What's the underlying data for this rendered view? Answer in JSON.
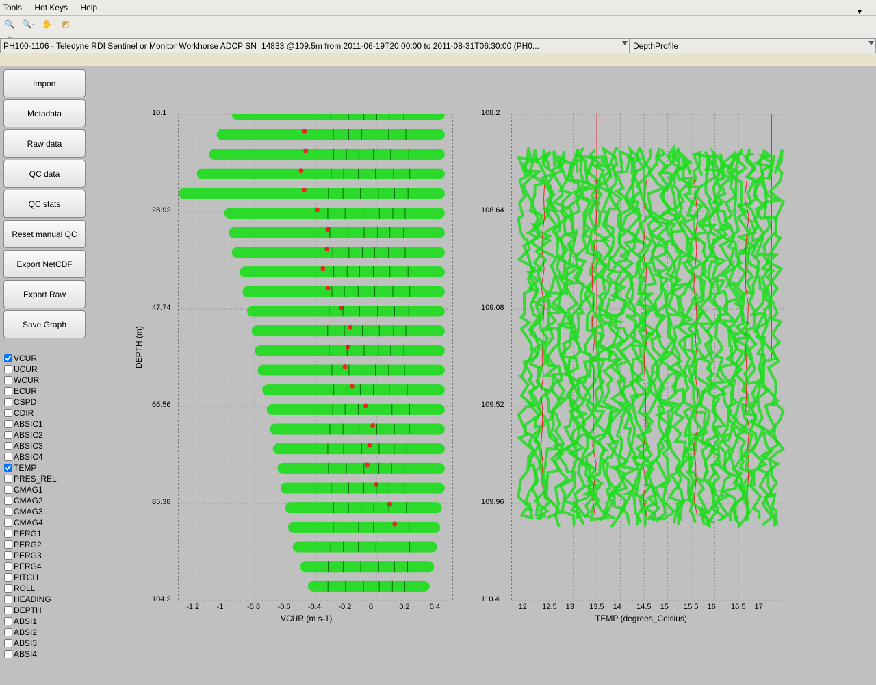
{
  "menu": {
    "tools": "Tools",
    "hotkeys": "Hot Keys",
    "help": "Help"
  },
  "dropdown1": "PH100-1106 - Teledyne RDI Sentinel or Monitor Workhorse ADCP SN=14833 @109.5m from 2011-06-19T20:00:00 to 2011-08-31T06:30:00 (PH0...",
  "dropdown2": "DepthProfile",
  "buttons": [
    "Import",
    "Metadata",
    "Raw data",
    "QC data",
    "QC stats",
    "Reset manual QC",
    "Export NetCDF",
    "Export Raw",
    "Save Graph"
  ],
  "vars": [
    {
      "name": "VCUR",
      "checked": true
    },
    {
      "name": "UCUR",
      "checked": false
    },
    {
      "name": "WCUR",
      "checked": false
    },
    {
      "name": "ECUR",
      "checked": false
    },
    {
      "name": "CSPD",
      "checked": false
    },
    {
      "name": "CDIR",
      "checked": false
    },
    {
      "name": "ABSIC1",
      "checked": false
    },
    {
      "name": "ABSIC2",
      "checked": false
    },
    {
      "name": "ABSIC3",
      "checked": false
    },
    {
      "name": "ABSIC4",
      "checked": false
    },
    {
      "name": "TEMP",
      "checked": true
    },
    {
      "name": "PRES_REL",
      "checked": false
    },
    {
      "name": "CMAG1",
      "checked": false
    },
    {
      "name": "CMAG2",
      "checked": false
    },
    {
      "name": "CMAG3",
      "checked": false
    },
    {
      "name": "CMAG4",
      "checked": false
    },
    {
      "name": "PERG1",
      "checked": false
    },
    {
      "name": "PERG2",
      "checked": false
    },
    {
      "name": "PERG3",
      "checked": false
    },
    {
      "name": "PERG4",
      "checked": false
    },
    {
      "name": "PITCH",
      "checked": false
    },
    {
      "name": "ROLL",
      "checked": false
    },
    {
      "name": "HEADING",
      "checked": false
    },
    {
      "name": "DEPTH",
      "checked": false
    },
    {
      "name": "ABSI1",
      "checked": false
    },
    {
      "name": "ABSI2",
      "checked": false
    },
    {
      "name": "ABSI3",
      "checked": false
    },
    {
      "name": "ABSI4",
      "checked": false
    }
  ],
  "chart_data": [
    {
      "type": "scatter-depth-profile",
      "title": "",
      "xlabel": "VCUR (m s-1)",
      "ylabel": "DEPTH (m)",
      "xlim": [
        -1.3,
        0.5
      ],
      "ylim": [
        104.2,
        10.1
      ],
      "xticks": [
        -1.2,
        -1,
        -0.8,
        -0.6,
        -0.4,
        -0.2,
        0,
        0.2,
        0.4
      ],
      "yticks": [
        10.1,
        28.92,
        47.74,
        66.56,
        85.38,
        104.2
      ],
      "bands": [
        {
          "depth": 10.1,
          "xmin": -0.95,
          "xmax": 0.45
        },
        {
          "depth": 14.0,
          "xmin": -1.05,
          "xmax": 0.45
        },
        {
          "depth": 17.8,
          "xmin": -1.1,
          "xmax": 0.45
        },
        {
          "depth": 21.6,
          "xmin": -1.18,
          "xmax": 0.45
        },
        {
          "depth": 25.4,
          "xmin": -1.3,
          "xmax": 0.45
        },
        {
          "depth": 29.2,
          "xmin": -1.0,
          "xmax": 0.45
        },
        {
          "depth": 33.0,
          "xmin": -0.97,
          "xmax": 0.45
        },
        {
          "depth": 36.8,
          "xmin": -0.95,
          "xmax": 0.45
        },
        {
          "depth": 40.6,
          "xmin": -0.9,
          "xmax": 0.45
        },
        {
          "depth": 44.4,
          "xmin": -0.88,
          "xmax": 0.45
        },
        {
          "depth": 48.2,
          "xmin": -0.85,
          "xmax": 0.45
        },
        {
          "depth": 52.0,
          "xmin": -0.82,
          "xmax": 0.45
        },
        {
          "depth": 55.8,
          "xmin": -0.8,
          "xmax": 0.45
        },
        {
          "depth": 59.6,
          "xmin": -0.78,
          "xmax": 0.45
        },
        {
          "depth": 63.4,
          "xmin": -0.75,
          "xmax": 0.45
        },
        {
          "depth": 67.2,
          "xmin": -0.72,
          "xmax": 0.45
        },
        {
          "depth": 71.0,
          "xmin": -0.7,
          "xmax": 0.45
        },
        {
          "depth": 74.8,
          "xmin": -0.68,
          "xmax": 0.45
        },
        {
          "depth": 78.6,
          "xmin": -0.65,
          "xmax": 0.45
        },
        {
          "depth": 82.4,
          "xmin": -0.63,
          "xmax": 0.45
        },
        {
          "depth": 86.2,
          "xmin": -0.6,
          "xmax": 0.43
        },
        {
          "depth": 90.0,
          "xmin": -0.58,
          "xmax": 0.42
        },
        {
          "depth": 93.8,
          "xmin": -0.55,
          "xmax": 0.4
        },
        {
          "depth": 97.6,
          "xmin": -0.5,
          "xmax": 0.38
        },
        {
          "depth": 101.4,
          "xmin": -0.45,
          "xmax": 0.35
        }
      ],
      "red_markers_x_approx": [
        -0.55,
        -0.45,
        -0.4,
        -0.35,
        -0.3,
        -0.25,
        -0.2,
        -0.15,
        -0.1,
        -0.05,
        0.0,
        0.05,
        0.1,
        0.12,
        0.15
      ]
    },
    {
      "type": "scatter-dense",
      "title": "",
      "xlabel": "TEMP (degrees_Celsius)",
      "ylabel": "",
      "xlim": [
        11.7,
        17.5
      ],
      "ylim": [
        110.4,
        108.2
      ],
      "xticks": [
        12,
        12.5,
        13,
        13.5,
        14,
        14.5,
        15,
        15.5,
        16,
        16.5,
        17
      ],
      "yticks": [
        108.2,
        108.64,
        109.08,
        109.52,
        109.96,
        110.4
      ],
      "note": "dense green cloud fully covering x-range 12–17.3, y-range 108.35–110.0; sparse red line fragments at x≈13.5 and x≈17.2 extending to top"
    }
  ]
}
